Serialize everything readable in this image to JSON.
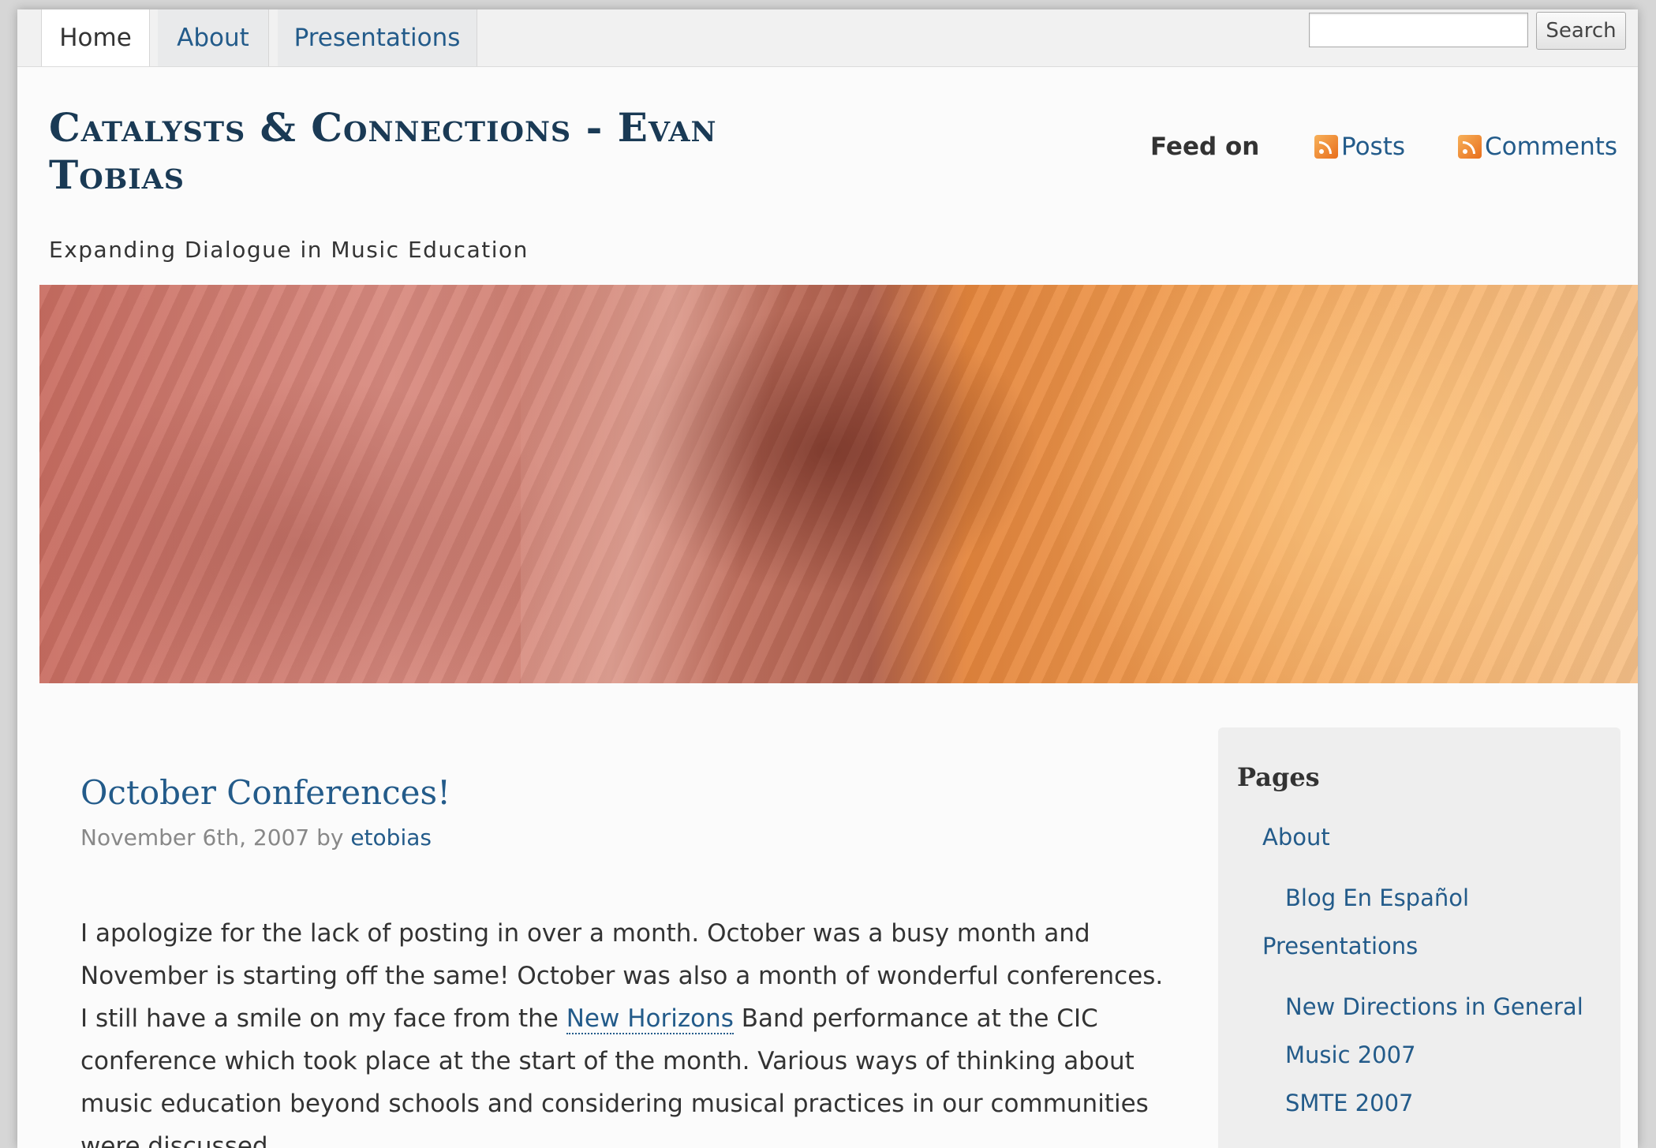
{
  "nav": {
    "tabs": [
      {
        "label": "Home",
        "active": true
      },
      {
        "label": "About",
        "active": false
      },
      {
        "label": "Presentations",
        "active": false
      }
    ],
    "search_button": "Search",
    "search_value": ""
  },
  "header": {
    "title_line1": "Catalysts & Connections - Evan",
    "title_line2": "Tobias",
    "description": "Expanding Dialogue in Music Education",
    "feed_label": "Feed on",
    "feed_posts": "Posts",
    "feed_comments": "Comments"
  },
  "post": {
    "title": "October Conferences!",
    "date": "November 6th, 2007",
    "by": "by",
    "author": "etobias",
    "body_part1": "I apologize for the lack of posting in over a month. October was a busy month and November is starting off the same! October was also a month of wonderful conferences. I still have a smile on my face from the ",
    "body_link": "New Horizons",
    "body_part2": " Band performance at the CIC conference which took place at the start of the month. Various ways of thinking about music education beyond schools and considering musical practices in our communities were discussed."
  },
  "sidebar": {
    "title": "Pages",
    "items": [
      {
        "label": "About"
      },
      {
        "label": "Blog En Español"
      },
      {
        "label": "Presentations"
      },
      {
        "label": "New Directions in General"
      },
      {
        "label": "Music 2007"
      },
      {
        "label": "SMTE 2007"
      }
    ]
  },
  "colors": {
    "link": "#235b8a",
    "title": "#1a3a55",
    "page_bg": "#fbfbfb",
    "outer_bg": "#d6d6d6"
  }
}
